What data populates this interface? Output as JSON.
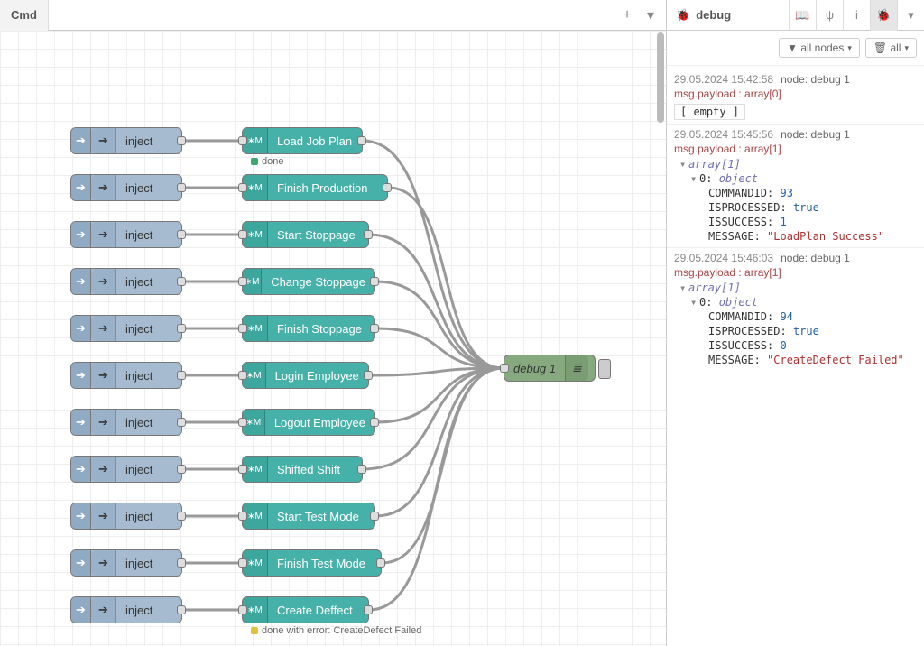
{
  "header": {
    "tab": "Cmd",
    "plus": "+",
    "caret": "▾",
    "sidebarTitle": "debug",
    "sbCaret": "▾"
  },
  "sidebarIcons": {
    "info": "i",
    "book": "📖",
    "branch": "ψ",
    "bug": "🐞",
    "caret": "▾"
  },
  "sbControls": {
    "filter": "▼ all nodes",
    "clear": "🗑 all"
  },
  "injectLabel": "inject",
  "arrowGlyph": "➔",
  "funcGlyph": "∗M",
  "debugGlyph": "≣",
  "funcNodes": [
    "Load Job Plan",
    "Finish Production",
    "Start Stoppage",
    "Change Stoppage",
    "Finish Stoppage",
    "Login Employee",
    "Logout Employee",
    "Shifted Shift",
    "Start Test Mode",
    "Finish Test Mode",
    "Create Deffect"
  ],
  "status1": {
    "text": "done",
    "color": "#3fa66f"
  },
  "status2": {
    "text": "done with error: CreateDefect Failed",
    "color": "#e3c23a"
  },
  "debugNodeLabel": "debug 1",
  "messages": [
    {
      "ts": "29.05.2024 15:42:58",
      "node": "node: debug 1",
      "topic": "msg.payload : array[0]",
      "empty": "[ empty ]"
    },
    {
      "ts": "29.05.2024 15:45:56",
      "node": "node: debug 1",
      "topic": "msg.payload : array[1]",
      "arr": "array[1]",
      "objLabel": "0:",
      "objType": "object",
      "kv": [
        {
          "k": "COMMANDID:",
          "v": "93",
          "t": "num"
        },
        {
          "k": "ISPROCESSED:",
          "v": "true",
          "t": "bool"
        },
        {
          "k": "ISSUCCESS:",
          "v": "1",
          "t": "num"
        },
        {
          "k": "MESSAGE:",
          "v": "\"LoadPlan Success\"",
          "t": "str"
        }
      ]
    },
    {
      "ts": "29.05.2024 15:46:03",
      "node": "node: debug 1",
      "topic": "msg.payload : array[1]",
      "arr": "array[1]",
      "objLabel": "0:",
      "objType": "object",
      "kv": [
        {
          "k": "COMMANDID:",
          "v": "94",
          "t": "num"
        },
        {
          "k": "ISPROCESSED:",
          "v": "true",
          "t": "bool"
        },
        {
          "k": "ISSUCCESS:",
          "v": "0",
          "t": "num"
        },
        {
          "k": "MESSAGE:",
          "v": "\"CreateDefect Failed\"",
          "t": "str"
        }
      ]
    }
  ]
}
